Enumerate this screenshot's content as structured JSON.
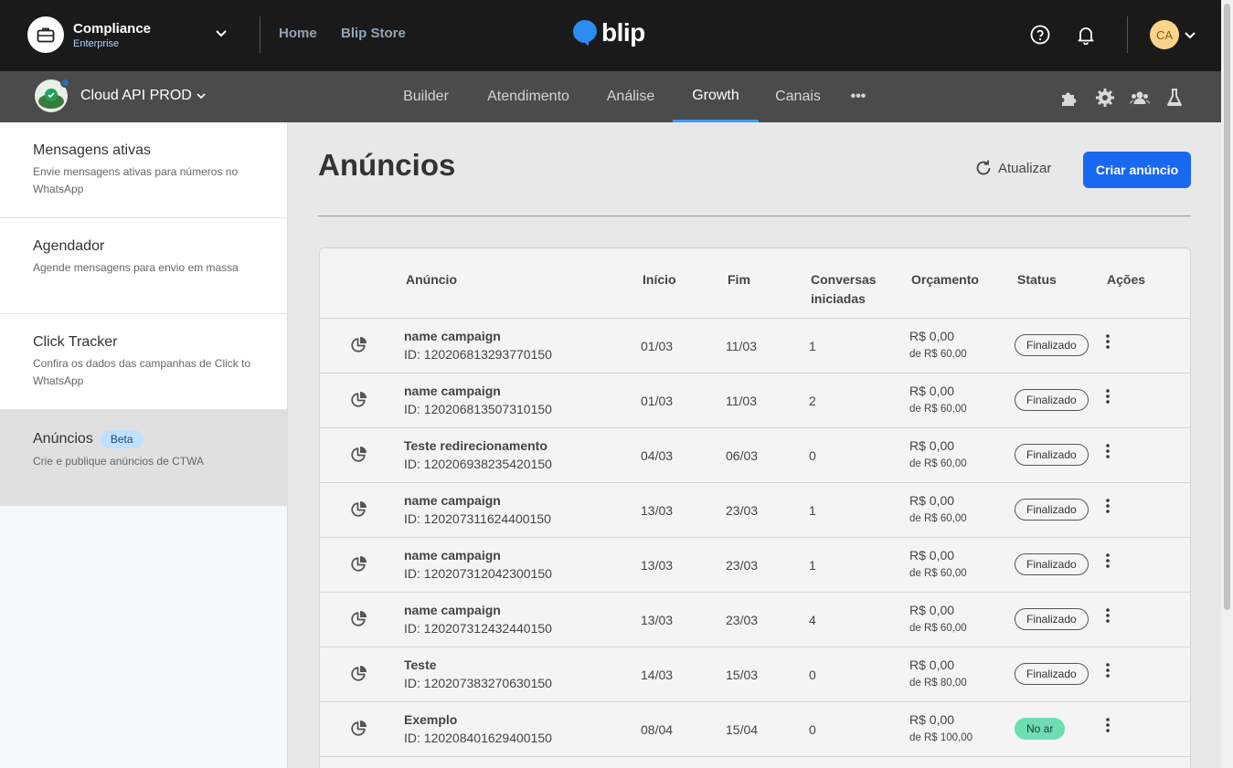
{
  "topbar": {
    "org_name": "Compliance",
    "org_plan": "Enterprise",
    "links": [
      "Home",
      "Blip Store"
    ],
    "brand": "blip",
    "avatar_initials": "CA",
    "icons": [
      "briefcase-icon",
      "chevron-down-icon",
      "help-icon",
      "bell-icon"
    ]
  },
  "subbar": {
    "bot_name": "Cloud API PROD",
    "tabs": [
      "Builder",
      "Atendimento",
      "Análise",
      "Growth",
      "Canais"
    ],
    "active_tab": "Growth",
    "more": "•••",
    "icons": [
      "puzzle-icon",
      "gear-icon",
      "team-icon",
      "flask-icon"
    ]
  },
  "sidebar": {
    "items": [
      {
        "title": "Mensagens ativas",
        "desc": "Envie mensagens ativas para números no WhatsApp"
      },
      {
        "title": "Agendador",
        "desc": "Agende mensagens para envio em massa"
      },
      {
        "title": "Click Tracker",
        "desc": "Confira os dados das campanhas de Click to WhatsApp"
      },
      {
        "title": "Anúncios",
        "badge": "Beta",
        "desc": "Crie e publique anúncios de CTWA"
      }
    ],
    "active_index": 3
  },
  "main": {
    "title": "Anúncios",
    "refresh_label": "Atualizar",
    "create_label": "Criar anúncio",
    "table": {
      "headers": {
        "anuncio": "Anúncio",
        "inicio": "Início",
        "fim": "Fim",
        "conversas_l1": "Conversas",
        "conversas_l2": "iniciadas",
        "orcamento": "Orçamento",
        "status": "Status",
        "acoes": "Ações"
      },
      "rows": [
        {
          "name": "name campaign",
          "id": "ID: 120206813293770150",
          "inicio": "01/03",
          "fim": "11/03",
          "conversas": "1",
          "gasto": "R$ 0,00",
          "total": "de R$ 60,00",
          "status": "Finalizado"
        },
        {
          "name": "name campaign",
          "id": "ID: 120206813507310150",
          "inicio": "01/03",
          "fim": "11/03",
          "conversas": "2",
          "gasto": "R$ 0,00",
          "total": "de R$ 60,00",
          "status": "Finalizado"
        },
        {
          "name": "Teste redirecionamento",
          "id": "ID: 120206938235420150",
          "inicio": "04/03",
          "fim": "06/03",
          "conversas": "0",
          "gasto": "R$ 0,00",
          "total": "de R$ 60,00",
          "status": "Finalizado"
        },
        {
          "name": "name campaign",
          "id": "ID: 120207311624400150",
          "inicio": "13/03",
          "fim": "23/03",
          "conversas": "1",
          "gasto": "R$ 0,00",
          "total": "de R$ 60,00",
          "status": "Finalizado"
        },
        {
          "name": "name campaign",
          "id": "ID: 120207312042300150",
          "inicio": "13/03",
          "fim": "23/03",
          "conversas": "1",
          "gasto": "R$ 0,00",
          "total": "de R$ 60,00",
          "status": "Finalizado"
        },
        {
          "name": "name campaign",
          "id": "ID: 120207312432440150",
          "inicio": "13/03",
          "fim": "23/03",
          "conversas": "4",
          "gasto": "R$ 0,00",
          "total": "de R$ 60,00",
          "status": "Finalizado"
        },
        {
          "name": "Teste",
          "id": "ID: 120207383270630150",
          "inicio": "14/03",
          "fim": "15/03",
          "conversas": "0",
          "gasto": "R$ 0,00",
          "total": "de R$ 80,00",
          "status": "Finalizado"
        },
        {
          "name": "Exemplo",
          "id": "ID: 120208401629400150",
          "inicio": "08/04",
          "fim": "15/04",
          "conversas": "0",
          "gasto": "R$ 0,00",
          "total": "de R$ 100,00",
          "status": "No ar"
        }
      ]
    }
  },
  "colors": {
    "topbar_bg": "#1a1a1a",
    "subbar_bg": "#4b4b4b",
    "accent": "#1968f0",
    "tab_underline": "#3e9df4",
    "live_badge": "#6fdcb4",
    "beta_badge": "#bfe0ff"
  }
}
